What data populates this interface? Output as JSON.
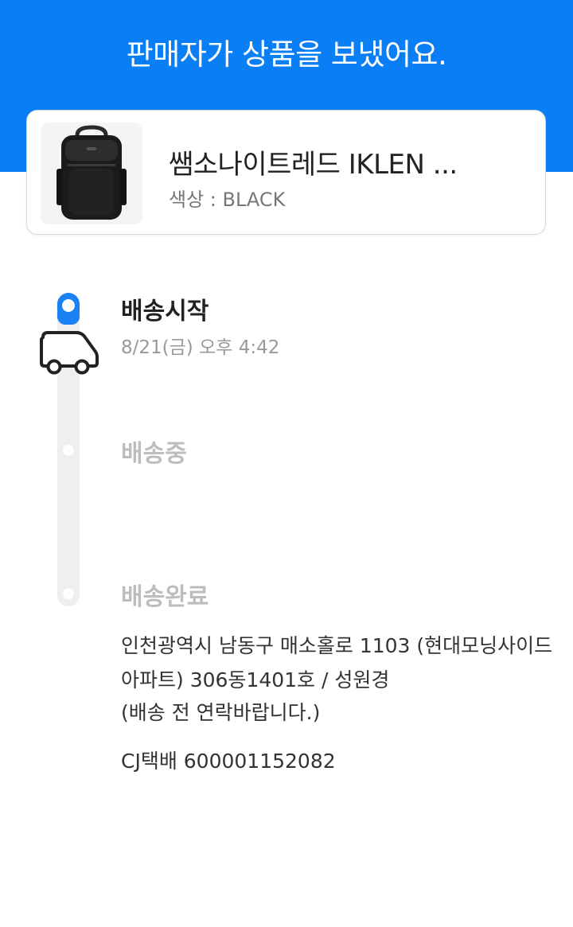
{
  "header": {
    "title": "판매자가 상품을 보냈어요."
  },
  "product": {
    "image_icon": "backpack-image",
    "name": "쌤소나이트레드 IKLEN ...",
    "option_label": "색상",
    "option_value": "BLACK"
  },
  "timeline": {
    "icon": "truck-icon",
    "steps": [
      {
        "label": "배송시작",
        "time": "8/21(금) 오후 4:42",
        "state": "active"
      },
      {
        "label": "배송중",
        "state": "inactive"
      },
      {
        "label": "배송완료",
        "state": "inactive"
      }
    ]
  },
  "delivery": {
    "address": "인천광역시 남동구 매소홀로 1103 (현대모닝사이드아파트) 306동1401호 / 성원경",
    "note": "(배송 전 연락바랍니다.)",
    "tracking": "CJ택배 600001152082"
  },
  "colors": {
    "primary": "#0a7ff5",
    "inactive_text": "#bdbdbd",
    "track": "#efefef"
  }
}
